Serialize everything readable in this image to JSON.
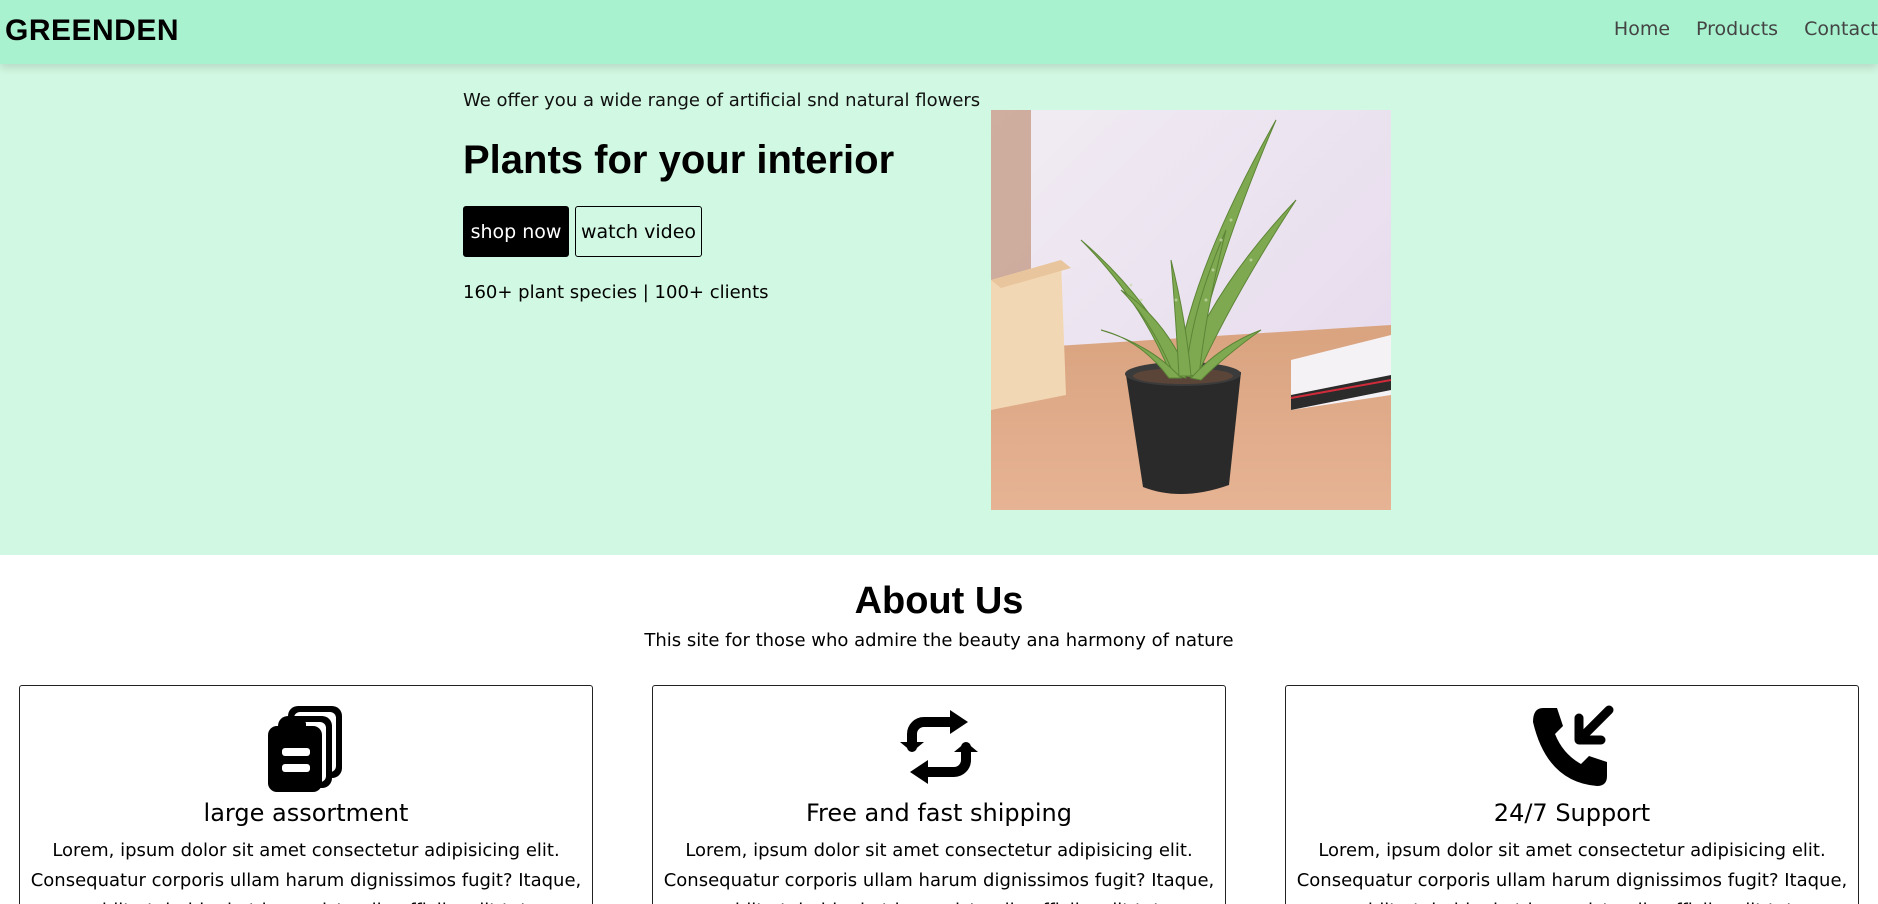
{
  "navbar": {
    "brand": "GREENDEN",
    "links": [
      "Home",
      "Products",
      "Contact"
    ]
  },
  "hero": {
    "tagline": "We offer you a wide range of artificial snd natural flowers",
    "title": "Plants for your interior",
    "shop_label": "shop now",
    "video_label": "watch video",
    "stats": "160+ plant species | 100+ clients",
    "image_icon": "aloe-plant-photo"
  },
  "about": {
    "title": "About Us",
    "subtitle": "This site for those who admire the beauty ana harmony of nature",
    "cards": [
      {
        "icon": "clipboard-stack-icon",
        "title": "large assortment",
        "text": "Lorem, ipsum dolor sit amet consectetur adipisicing elit. Consequatur corporis ullam harum dignissimos fugit? Itaque, quidit ateimidqui at ipsum iste ullo officiis adit tet."
      },
      {
        "icon": "arrows-repeat-icon",
        "title": "Free and fast shipping",
        "text": "Lorem, ipsum dolor sit amet consectetur adipisicing elit. Consequatur corporis ullam harum dignissimos fugit? Itaque, quidit ateimidqui at ipsum iste ullo officiis adit tet."
      },
      {
        "icon": "phone-incoming-icon",
        "title": "24/7 Support",
        "text": "Lorem, ipsum dolor sit amet consectetur adipisicing elit. Consequatur corporis ullam harum dignissimos fugit? Itaque, quidit ateimidqui at ipsum iste ullo officiis adit tet."
      }
    ]
  },
  "colors": {
    "navbar_bg": "#a8f2d0",
    "hero_bg": "#d1f8e2",
    "primary_button": "#000000"
  }
}
